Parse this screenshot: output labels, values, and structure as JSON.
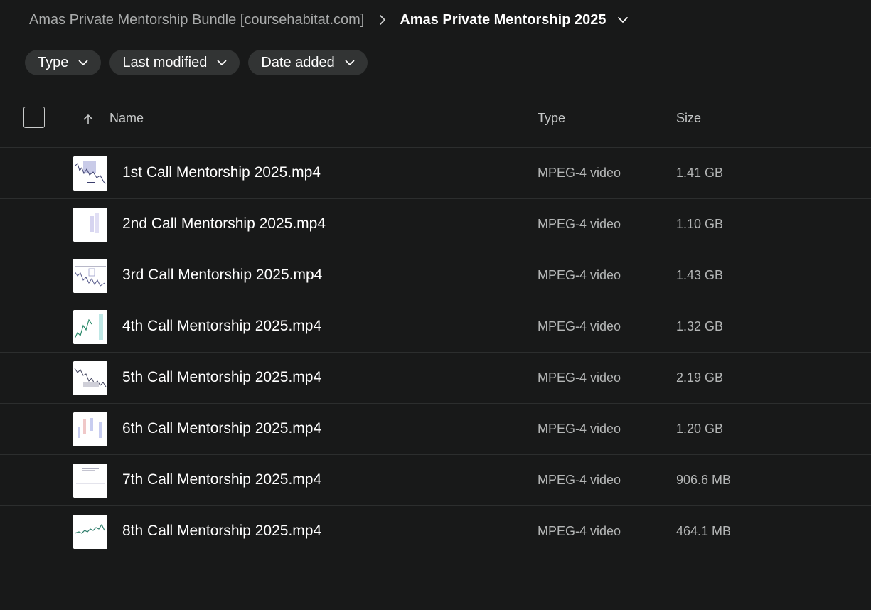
{
  "breadcrumb": {
    "parent": "Amas Private Mentorship Bundle [coursehabitat.com]",
    "current": "Amas Private Mentorship 2025"
  },
  "filters": [
    {
      "label": "Type"
    },
    {
      "label": "Last modified"
    },
    {
      "label": "Date added"
    }
  ],
  "table": {
    "columns": {
      "name": "Name",
      "type": "Type",
      "size": "Size"
    },
    "sort": "ascending-by-name",
    "rows": [
      {
        "name": "1st Call Mentorship 2025.mp4",
        "type": "MPEG-4 video",
        "size": "1.41 GB"
      },
      {
        "name": "2nd Call Mentorship 2025.mp4",
        "type": "MPEG-4 video",
        "size": "1.10 GB"
      },
      {
        "name": "3rd Call Mentorship 2025.mp4",
        "type": "MPEG-4 video",
        "size": "1.43 GB"
      },
      {
        "name": "4th Call Mentorship 2025.mp4",
        "type": "MPEG-4 video",
        "size": "1.32 GB"
      },
      {
        "name": "5th Call Mentorship 2025.mp4",
        "type": "MPEG-4 video",
        "size": "2.19 GB"
      },
      {
        "name": "6th Call Mentorship 2025.mp4",
        "type": "MPEG-4 video",
        "size": "1.20 GB"
      },
      {
        "name": "7th Call Mentorship 2025.mp4",
        "type": "MPEG-4 video",
        "size": "906.6 MB"
      },
      {
        "name": "8th Call Mentorship 2025.mp4",
        "type": "MPEG-4 video",
        "size": "464.1 MB"
      }
    ]
  },
  "icons": {
    "breadcrumb_separator": "chevron-right-icon",
    "breadcrumb_menu": "chevron-down-icon",
    "filter_caret": "chevron-down-icon",
    "sort": "arrow-up-icon",
    "thumbnail": "video-thumbnail"
  },
  "colors": {
    "background": "#181919",
    "chip": "#323434",
    "divider": "#2c2e2e",
    "muted_text": "#b4b6b6"
  }
}
